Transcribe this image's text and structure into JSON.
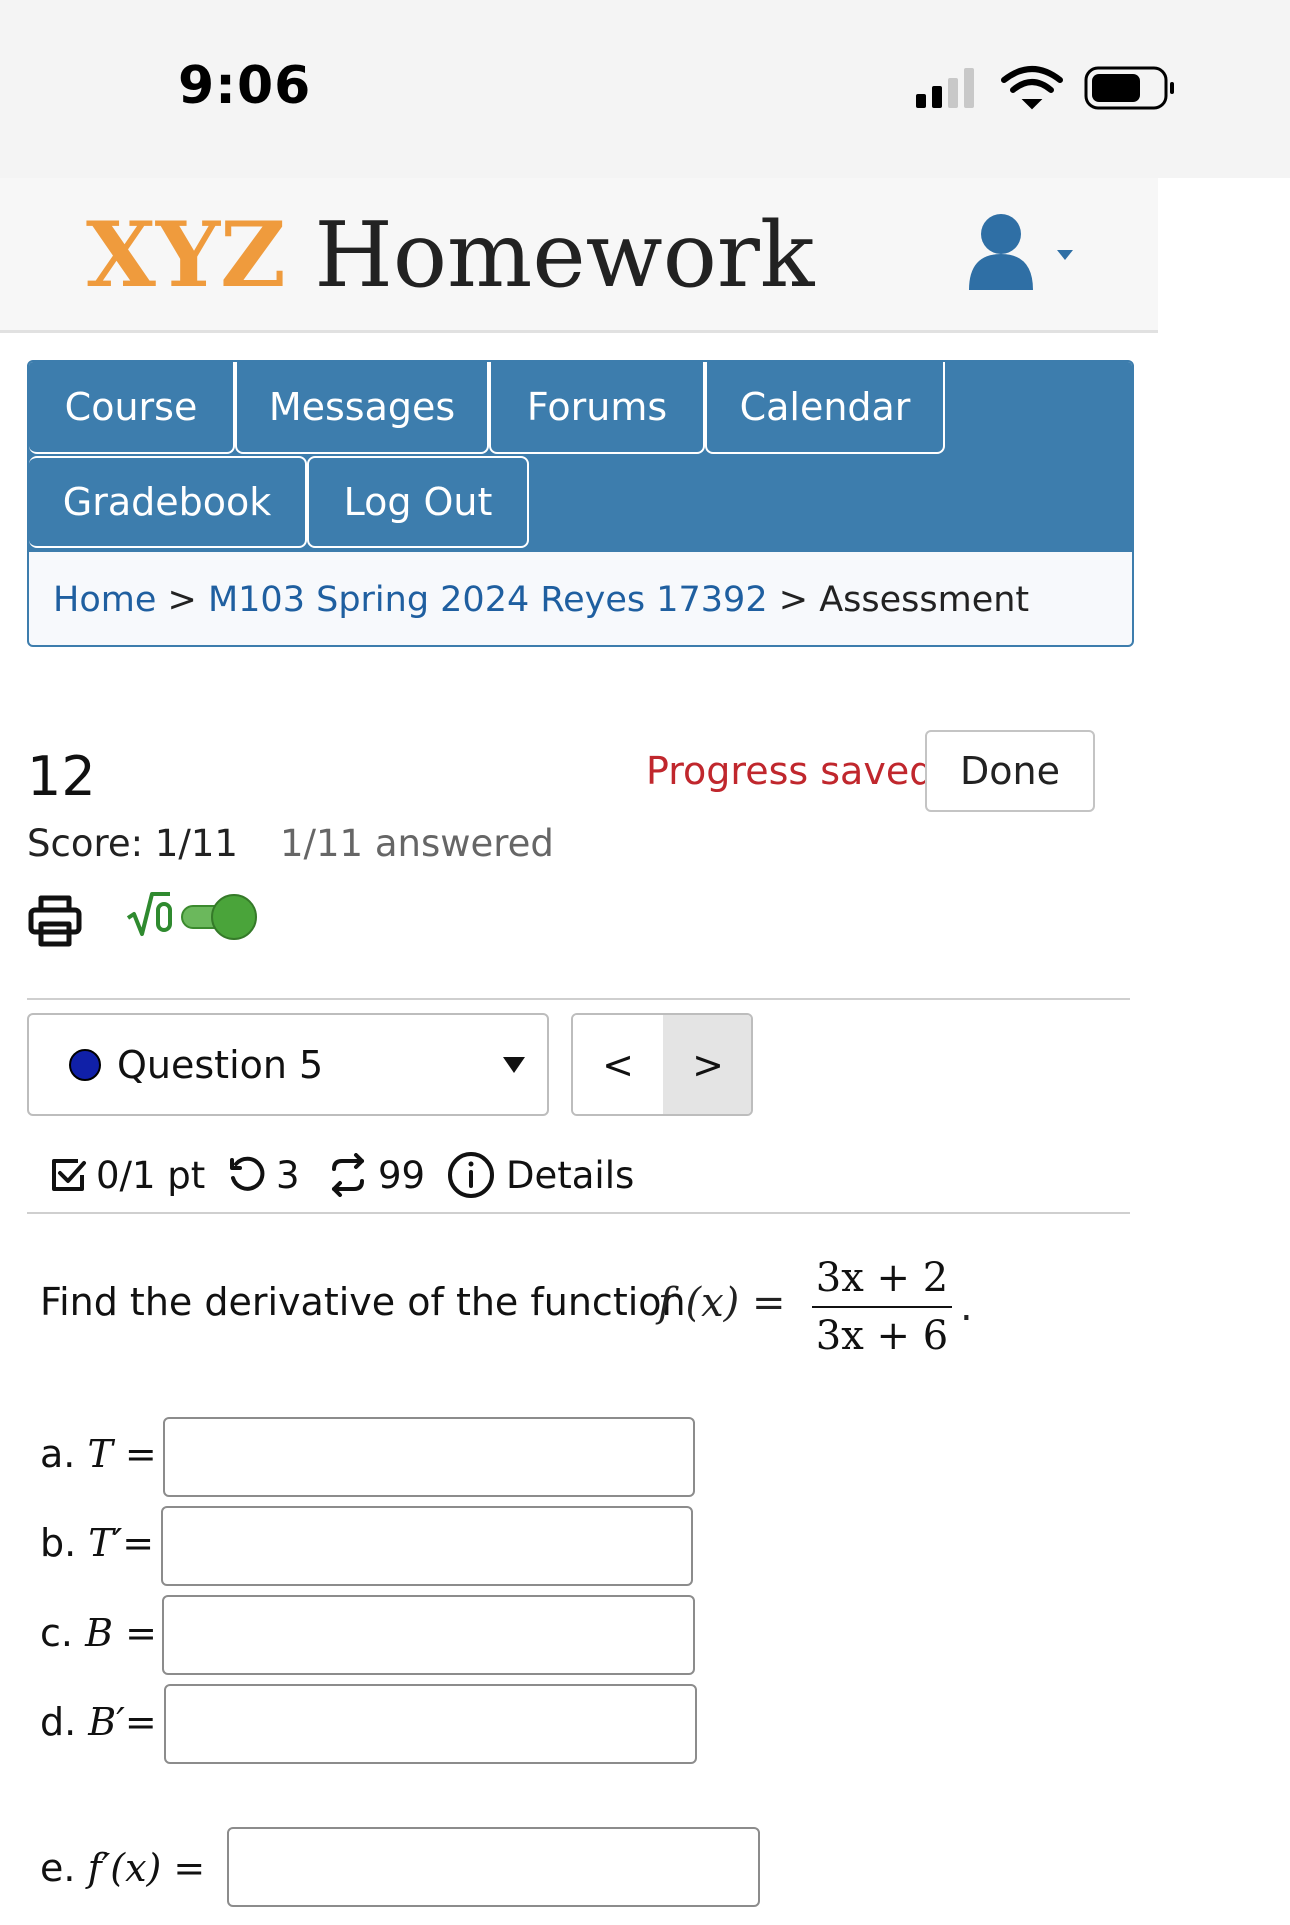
{
  "status_bar": {
    "time": "9:06"
  },
  "header": {
    "brand_xyz": "XYZ",
    "brand_rest": "Homework"
  },
  "nav": {
    "tabs": [
      {
        "label": "Course"
      },
      {
        "label": "Messages"
      },
      {
        "label": "Forums"
      },
      {
        "label": "Calendar"
      },
      {
        "label": "Gradebook"
      },
      {
        "label": "Log Out"
      }
    ]
  },
  "breadcrumb": {
    "home": "Home",
    "sep": ">",
    "course": "M103 Spring 2024 Reyes 17392",
    "current": "Assessment"
  },
  "assessment": {
    "number": "12",
    "progress_text": "Progress saved",
    "done_label": "Done",
    "score": "Score: 1/11",
    "answered": "1/11 answered"
  },
  "question_nav": {
    "selected": "Question 5",
    "prev": "<",
    "next": ">"
  },
  "meta": {
    "points": "0/1 pt",
    "retries": "3",
    "attempts": "99",
    "details": "Details"
  },
  "question": {
    "prompt": "Find the derivative of the function",
    "function_lhs": "f (x) =",
    "numerator": "3x + 2",
    "denominator": "3x + 6",
    "end": "."
  },
  "answers": [
    {
      "prefix": "a.",
      "math": "T =",
      "value": ""
    },
    {
      "prefix": "b.",
      "math": "T′=",
      "value": ""
    },
    {
      "prefix": "c.",
      "math": "B =",
      "value": ""
    },
    {
      "prefix": "d.",
      "math": "B′=",
      "value": ""
    },
    {
      "prefix": "e.",
      "math": "f′(x) =",
      "value": ""
    }
  ],
  "colors": {
    "brand_orange": "#ef9b3d",
    "nav_blue": "#3d7dad",
    "progress_red": "#c0272d",
    "toggle_green": "#4aa43a",
    "question_dot": "#1020a8"
  }
}
